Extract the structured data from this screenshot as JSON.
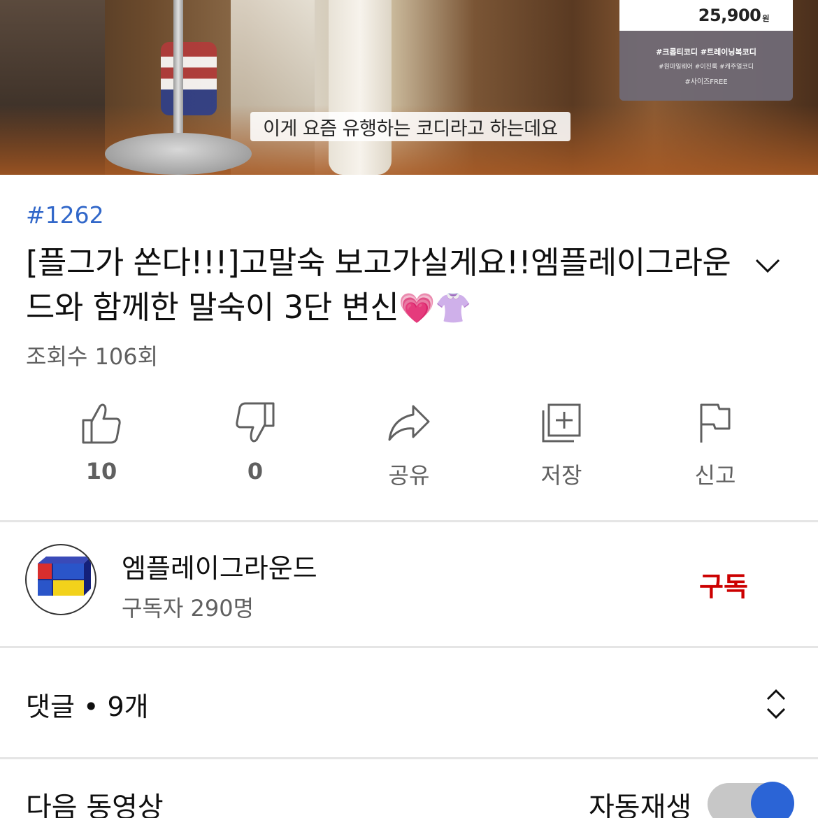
{
  "video": {
    "caption": "이게 요즘 유행하는 코디라고 하는데요",
    "price": "25,900",
    "currency": "원",
    "tags_line1": "#크롭티코디 #트레이닝복코디",
    "tags_line2": "#원마일웨어 #이진룩 #캐주얼코디",
    "tags_line3": "#사이즈FREE"
  },
  "info": {
    "hashtag": "#1262",
    "title": "[플그가 쏜다!!!]고말숙 보고가실게요!!엠플레이그라운드와 함께한 말숙이 3단 변신",
    "title_emojis": "💗👚",
    "views": "조회수 106회"
  },
  "actions": {
    "like_count": "10",
    "dislike_count": "0",
    "share_label": "공유",
    "save_label": "저장",
    "report_label": "신고"
  },
  "channel": {
    "name": "엠플레이그라운드",
    "subscribers": "구독자 290명",
    "subscribe_label": "구독"
  },
  "comments": {
    "label": "댓글 • 9개"
  },
  "up_next": {
    "label": "다음 동영상",
    "autoplay_label": "자동재생",
    "autoplay_on": true
  },
  "colors": {
    "hashtag": "#3167c9",
    "subscribe": "#cc0000",
    "toggle_knob": "#2b64d6"
  }
}
